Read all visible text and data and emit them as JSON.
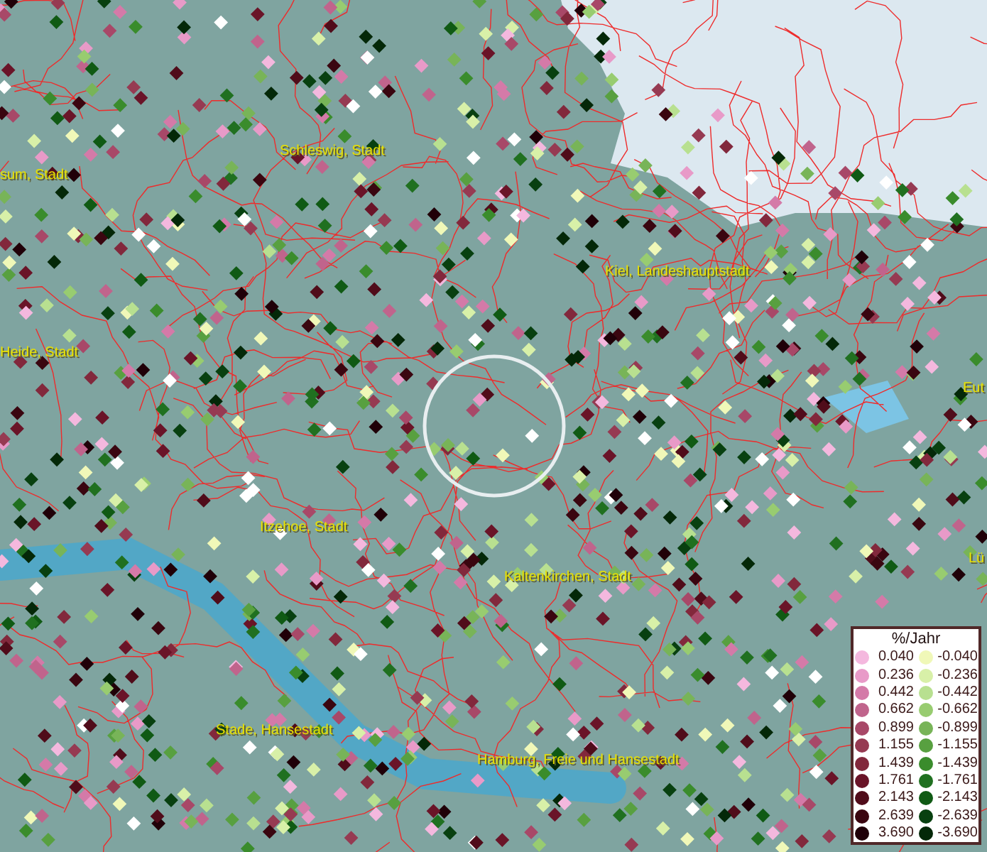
{
  "map": {
    "place_labels": [
      {
        "text": "sum, Stadt"
      },
      {
        "text": "Schleswig, Stadt"
      },
      {
        "text": "Kiel, Landeshauptstadt"
      },
      {
        "text": "Heide, Stadt"
      },
      {
        "text": "Eut"
      },
      {
        "text": "Itzehoe, Stadt"
      },
      {
        "text": "Kaltenkirchen, Stadt"
      },
      {
        "text": "Lü"
      },
      {
        "text": "Stade, Hansestadt"
      },
      {
        "text": "Hamburg, Freie und Hansestadt"
      }
    ]
  },
  "legend": {
    "title": "%/Jahr",
    "positive": [
      {
        "value": "0.040",
        "color": "#f4b8de"
      },
      {
        "value": "0.236",
        "color": "#e89ac8"
      },
      {
        "value": "0.442",
        "color": "#d47aa8"
      },
      {
        "value": "0.662",
        "color": "#c0648c"
      },
      {
        "value": "0.899",
        "color": "#a84868"
      },
      {
        "value": "1.155",
        "color": "#963a52"
      },
      {
        "value": "1.439",
        "color": "#82283c"
      },
      {
        "value": "1.761",
        "color": "#6a1428"
      },
      {
        "value": "2.143",
        "color": "#500c1a"
      },
      {
        "value": "2.639",
        "color": "#3a0610"
      },
      {
        "value": "3.690",
        "color": "#200008"
      }
    ],
    "negative": [
      {
        "value": "-0.040",
        "color": "#f0f8b8"
      },
      {
        "value": "-0.236",
        "color": "#d8f0a8"
      },
      {
        "value": "-0.442",
        "color": "#b8e090"
      },
      {
        "value": "-0.662",
        "color": "#98cc70"
      },
      {
        "value": "-0.899",
        "color": "#78b458"
      },
      {
        "value": "-1.155",
        "color": "#58a040"
      },
      {
        "value": "-1.439",
        "color": "#3a8c2c"
      },
      {
        "value": "-1.761",
        "color": "#207020"
      },
      {
        "value": "-2.143",
        "color": "#105a14"
      },
      {
        "value": "-2.639",
        "color": "#084010"
      },
      {
        "value": "-3.690",
        "color": "#042808"
      }
    ]
  }
}
